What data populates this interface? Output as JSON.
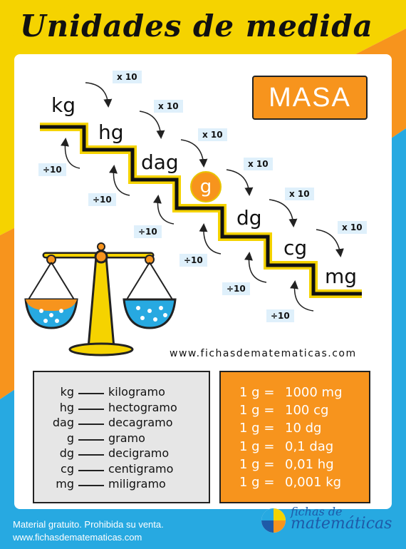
{
  "title": "Unidades de medida",
  "badge": "MASA",
  "units": {
    "kg": "kg",
    "hg": "hg",
    "dag": "dag",
    "g": "g",
    "dg": "dg",
    "cg": "cg",
    "mg": "mg"
  },
  "ops": {
    "multiply": "x 10",
    "divide": "÷10"
  },
  "website": "www.fichasdematematicas.com",
  "legend": [
    {
      "abbr": "kg",
      "name": "kilogramo"
    },
    {
      "abbr": "hg",
      "name": "hectogramo"
    },
    {
      "abbr": "dag",
      "name": "decagramo"
    },
    {
      "abbr": "g",
      "name": "gramo"
    },
    {
      "abbr": "dg",
      "name": "decigramo"
    },
    {
      "abbr": "cg",
      "name": "centigramo"
    },
    {
      "abbr": "mg",
      "name": "miligramo"
    }
  ],
  "equivalences": [
    {
      "lhs": "1 g =",
      "rhs": "1000 mg"
    },
    {
      "lhs": "1 g =",
      "rhs": "100 cg"
    },
    {
      "lhs": "1 g =",
      "rhs": "10 dg"
    },
    {
      "lhs": "1 g =",
      "rhs": "0,1 dag"
    },
    {
      "lhs": "1 g =",
      "rhs": "0,01 hg"
    },
    {
      "lhs": "1 g =",
      "rhs": "0,001 kg"
    }
  ],
  "footer": {
    "line1": "Material gratuito. Prohibida su venta.",
    "line2": "www.fichasdematematicas.com"
  },
  "logo": {
    "line1": "fichas de",
    "line2": "matemáticas"
  },
  "colors": {
    "yellow": "#f5d300",
    "orange": "#f7941d",
    "blue": "#27a9e1",
    "stair_outline": "#f5d300"
  },
  "icons": [
    "balance-scale-icon",
    "logo-mark-icon",
    "arrow-icon"
  ]
}
